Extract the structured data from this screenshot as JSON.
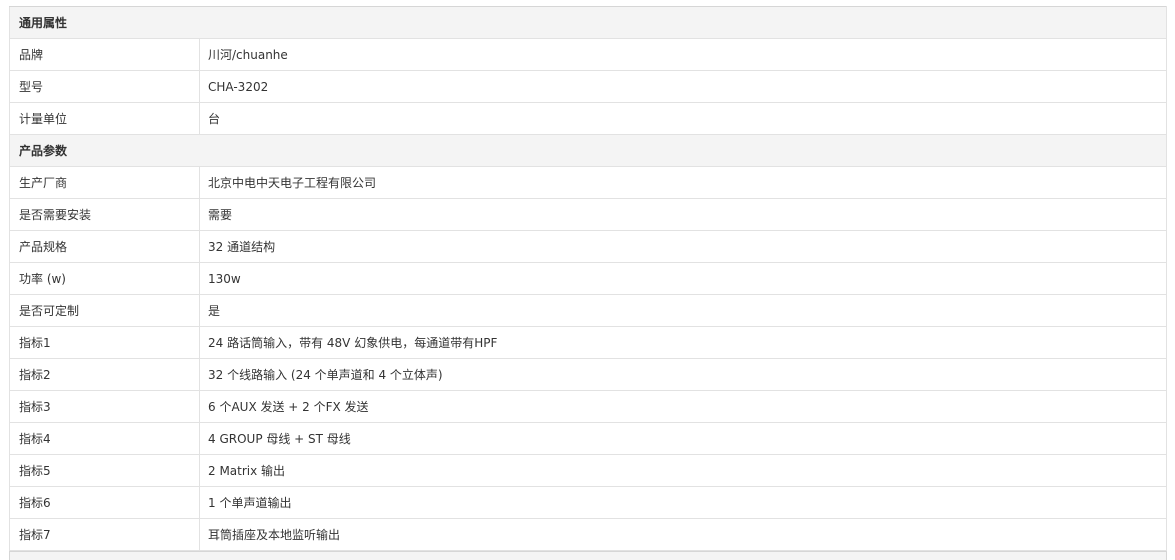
{
  "sections": [
    {
      "title": "通用属性",
      "rows": [
        {
          "key": "品牌",
          "value": "川河/chuanhe"
        },
        {
          "key": "型号",
          "value": "CHA-3202"
        },
        {
          "key": "计量单位",
          "value": "台"
        }
      ]
    },
    {
      "title": "产品参数",
      "rows": [
        {
          "key": "生产厂商",
          "value": "北京中电中天电子工程有限公司"
        },
        {
          "key": "是否需要安装",
          "value": "需要"
        },
        {
          "key": "产品规格",
          "value": "32 通道结构"
        },
        {
          "key": "功率 (w)",
          "value": "130w"
        },
        {
          "key": "是否可定制",
          "value": "是"
        },
        {
          "key": "指标1",
          "value": "24 路话筒输入，带有 48V 幻象供电，每通道带有HPF"
        },
        {
          "key": "指标2",
          "value": "32 个线路输入 (24 个单声道和 4 个立体声)"
        },
        {
          "key": "指标3",
          "value": "6 个AUX 发送 + 2 个FX 发送"
        },
        {
          "key": "指标4",
          "value": "4 GROUP 母线 + ST 母线"
        },
        {
          "key": "指标5",
          "value": "2 Matrix 输出"
        },
        {
          "key": "指标6",
          "value": "1 个单声道输出"
        },
        {
          "key": "指标7",
          "value": "耳筒插座及本地监听输出"
        }
      ]
    }
  ]
}
